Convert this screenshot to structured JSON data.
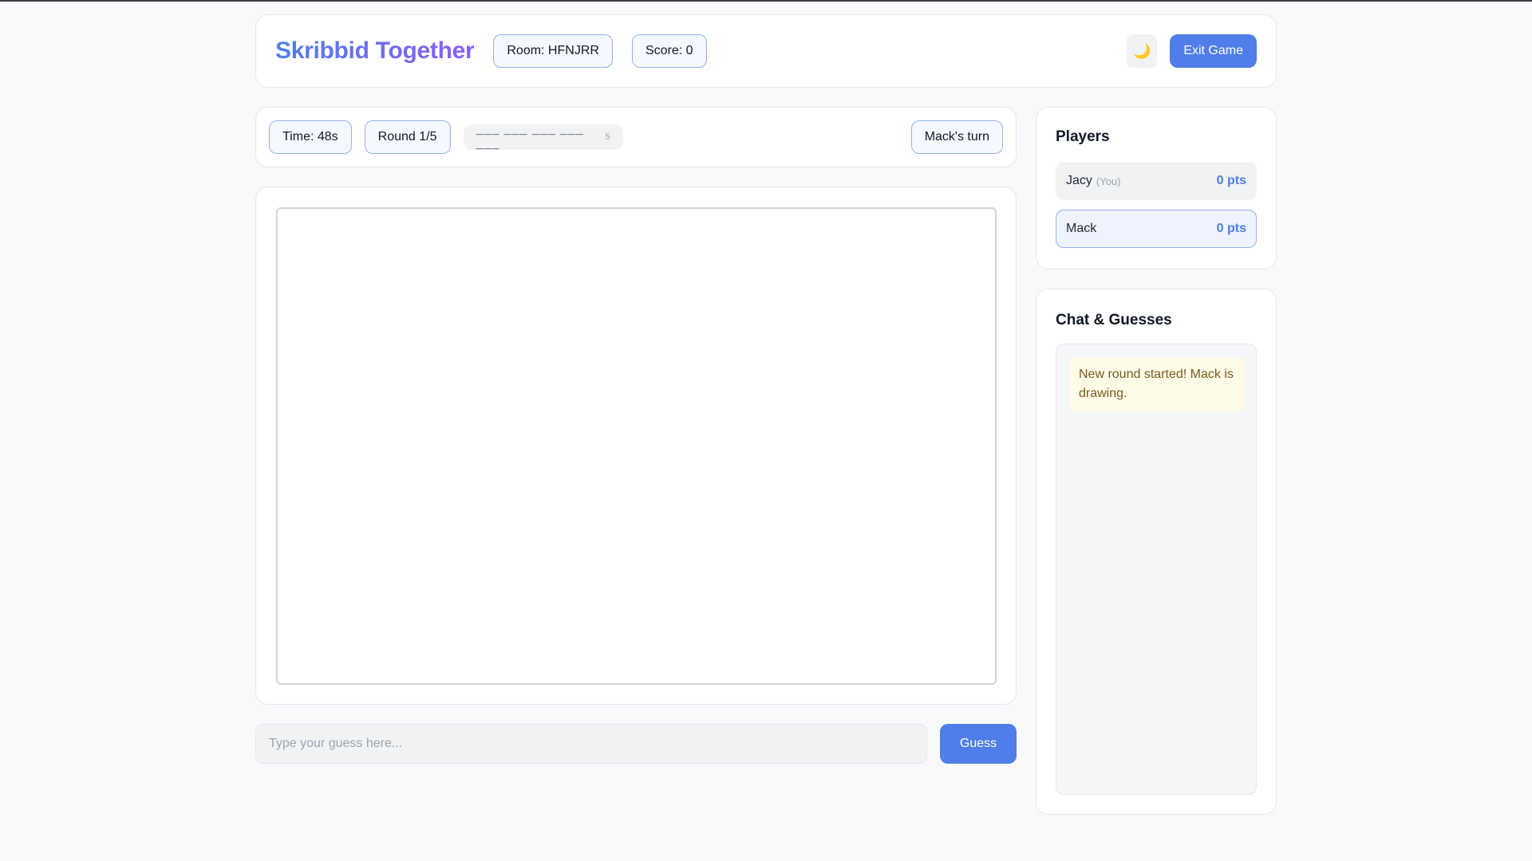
{
  "header": {
    "title": "Skribbid Together",
    "room": "Room: HFNJRR",
    "score": "Score: 0",
    "theme_toggle_glyph": "🌙",
    "exit_label": "Exit Game"
  },
  "status": {
    "time": "Time: 48s",
    "round": "Round 1/5",
    "word_blanks": "___ ___ ___ ___ ___",
    "word_length": "5",
    "turn": "Mack's turn"
  },
  "guess": {
    "placeholder": "Type your guess here...",
    "button_label": "Guess"
  },
  "players": {
    "title": "Players",
    "items": [
      {
        "name": "Jacy",
        "tag": "(You)",
        "points": "0 pts"
      },
      {
        "name": "Mack",
        "tag": "",
        "points": "0 pts"
      }
    ]
  },
  "chat": {
    "title": "Chat & Guesses",
    "messages": [
      "New round started! Mack is drawing."
    ]
  },
  "colors": {
    "accent": "#4f7ee8",
    "brand_gradient_end": "#8b5cf6",
    "system_message_bg": "#fefbe8"
  }
}
